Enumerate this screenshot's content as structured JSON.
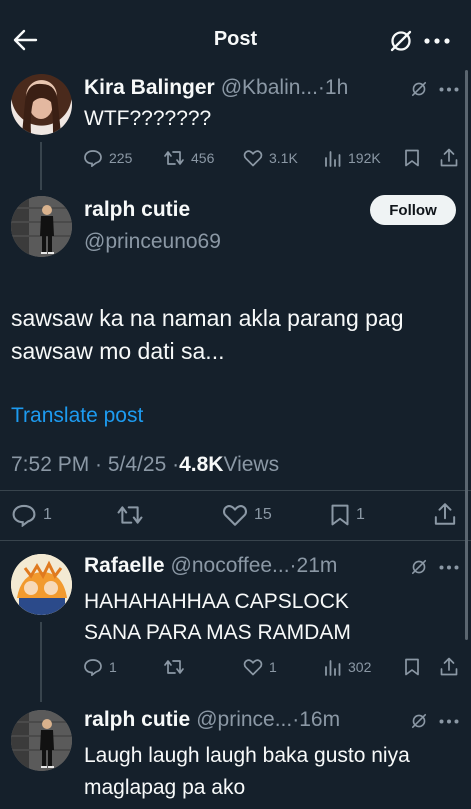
{
  "header": {
    "title": "Post"
  },
  "parent_tweet": {
    "name": "Kira Balinger",
    "handle_time": "@Kbalin...·1h",
    "text": "WTF???????",
    "stats": {
      "replies": "225",
      "reposts": "456",
      "likes": "3.1K",
      "views": "192K"
    }
  },
  "main_tweet": {
    "name": "ralph cutie",
    "handle": "@princeuno69",
    "follow_label": "Follow",
    "text": "sawsaw ka na naman akla parang pag sawsaw mo dati sa...",
    "translate_label": "Translate post",
    "timestamp": "7:52 PM · 5/4/25 · ",
    "views_count": "4.8K",
    "views_label": " Views",
    "stats": {
      "replies": "1",
      "likes": "15",
      "bookmarks": "1"
    }
  },
  "replies": [
    {
      "name": "Rafaelle",
      "handle_time": "@nocoffee...·21m",
      "text": "HAHAHAHHAA CAPSLOCK SANA PARA MAS RAMDAM",
      "stats": {
        "replies": "1",
        "likes": "1",
        "views": "302"
      }
    },
    {
      "name": "ralph cutie",
      "handle_time": "@prince...·16m",
      "text": "Laugh laugh laugh baka gusto niya maglapag pa ako"
    }
  ],
  "colors": {
    "background": "#15202b",
    "muted": "#8b98a5",
    "link": "#1d9bf0",
    "divider": "#38444d"
  },
  "icons": [
    "back-arrow-icon",
    "grok-icon",
    "more-icon",
    "reply-icon",
    "repost-icon",
    "like-icon",
    "views-icon",
    "bookmark-icon",
    "share-icon"
  ]
}
